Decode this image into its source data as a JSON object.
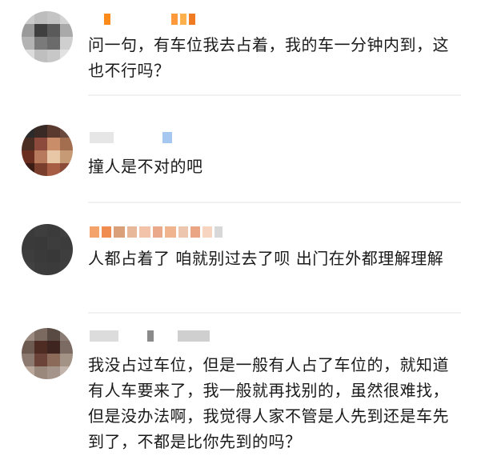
{
  "comments": [
    {
      "text": "问一句，有车位我去占着，我的车一分钟内到，这也不行吗？"
    },
    {
      "text": "撞人是不对的吧"
    },
    {
      "text": "人都占着了 咱就别过去了呗 出门在外都理解理解"
    },
    {
      "text": "我没占过车位，但是一般有人占了车位的，就知道有人车要来了，我一般就再找别的，虽然很难找，但是没办法啊，我觉得人家不管是人先到还是车先到了，不都是比你先到的吗？"
    }
  ]
}
